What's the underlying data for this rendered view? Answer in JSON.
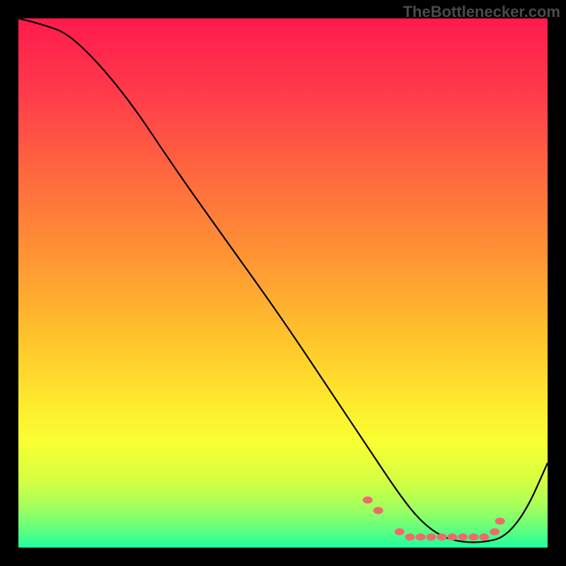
{
  "watermark": "TheBottlenecker.com",
  "gradient_stops": [
    {
      "offset": 0.0,
      "color": "#ff1a4d"
    },
    {
      "offset": 0.15,
      "color": "#ff3d4a"
    },
    {
      "offset": 0.3,
      "color": "#ff6a3e"
    },
    {
      "offset": 0.45,
      "color": "#ff9434"
    },
    {
      "offset": 0.6,
      "color": "#ffc22c"
    },
    {
      "offset": 0.72,
      "color": "#ffe82e"
    },
    {
      "offset": 0.8,
      "color": "#f9ff32"
    },
    {
      "offset": 0.87,
      "color": "#d7ff40"
    },
    {
      "offset": 0.92,
      "color": "#a8ff5a"
    },
    {
      "offset": 0.96,
      "color": "#6bff7a"
    },
    {
      "offset": 1.0,
      "color": "#1fff9e"
    }
  ],
  "chart_data": {
    "type": "line",
    "title": "",
    "xlabel": "",
    "ylabel": "",
    "xlim": [
      0,
      100
    ],
    "ylim": [
      0,
      100
    ],
    "series": [
      {
        "name": "curve",
        "x": [
          0,
          4,
          10,
          20,
          30,
          40,
          50,
          60,
          66,
          72,
          76,
          80,
          84,
          88,
          92,
          96,
          100
        ],
        "y": [
          100,
          99,
          97,
          86,
          71,
          57,
          43,
          28,
          19,
          10,
          5,
          2,
          1,
          1,
          2,
          7,
          16
        ]
      }
    ],
    "markers": {
      "x": [
        66,
        68,
        72,
        74,
        76,
        78,
        80,
        82,
        84,
        86,
        88,
        90,
        91
      ],
      "y": [
        9,
        7,
        3,
        2,
        2,
        2,
        2,
        2,
        2,
        2,
        2,
        3,
        5
      ]
    }
  }
}
